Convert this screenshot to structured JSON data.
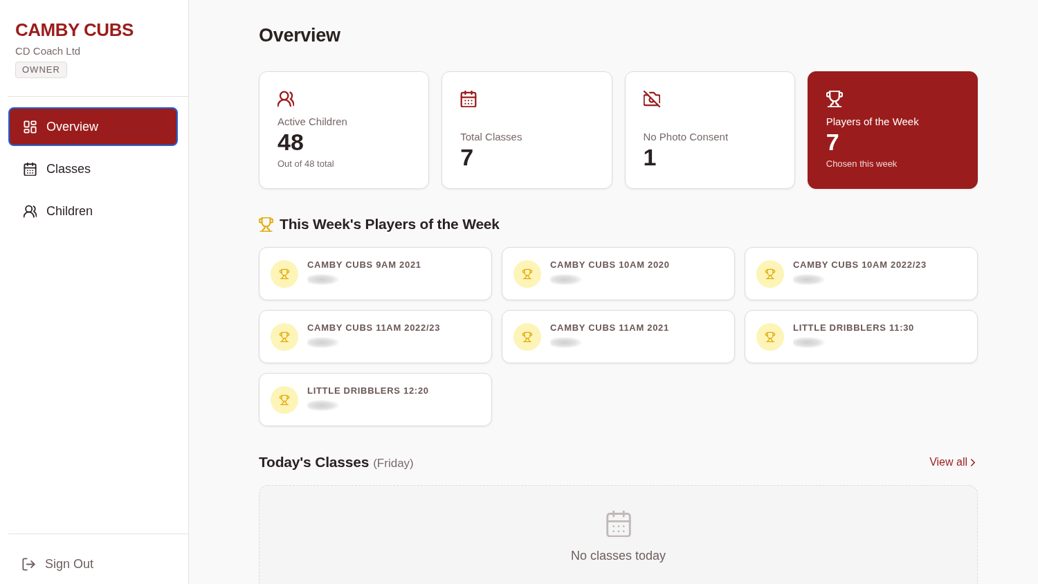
{
  "sidebar": {
    "brand": "CAMBY CUBS",
    "organisation": "CD Coach Ltd",
    "role_badge": "OWNER",
    "nav_items": [
      {
        "label": "Overview",
        "selected": true,
        "focused": true
      },
      {
        "label": "Classes",
        "selected": false,
        "focused": false
      },
      {
        "label": "Children",
        "selected": false,
        "focused": false
      }
    ],
    "sign_out": "Sign Out"
  },
  "main": {
    "title": "Overview",
    "stats": [
      {
        "label": "Active Children",
        "value": "48",
        "note": "Out of 48 total",
        "highlighted": false
      },
      {
        "label": "Total Classes",
        "value": "7",
        "highlighted": false
      },
      {
        "label": "No Photo Consent",
        "value": "1",
        "highlighted": false
      },
      {
        "label": "Players of the Week",
        "value": "7",
        "note": "Chosen this week",
        "highlighted": true
      }
    ],
    "players_section": {
      "title": "This Week's Players of the Week",
      "cards": [
        {
          "class_name": "CAMBY CUBS 9AM 2021"
        },
        {
          "class_name": "CAMBY CUBS 10AM 2020"
        },
        {
          "class_name": "CAMBY CUBS 10AM 2022/23"
        },
        {
          "class_name": "CAMBY CUBS 11AM 2022/23"
        },
        {
          "class_name": "CAMBY CUBS 11AM 2021"
        },
        {
          "class_name": "LITTLE DRIBBLERS 11:30"
        },
        {
          "class_name": "LITTLE DRIBBLERS 12:20"
        }
      ]
    },
    "todays_classes": {
      "title": "Today's Classes",
      "day": "(Friday)",
      "view_all": "View all",
      "empty_message": "No classes today"
    }
  }
}
